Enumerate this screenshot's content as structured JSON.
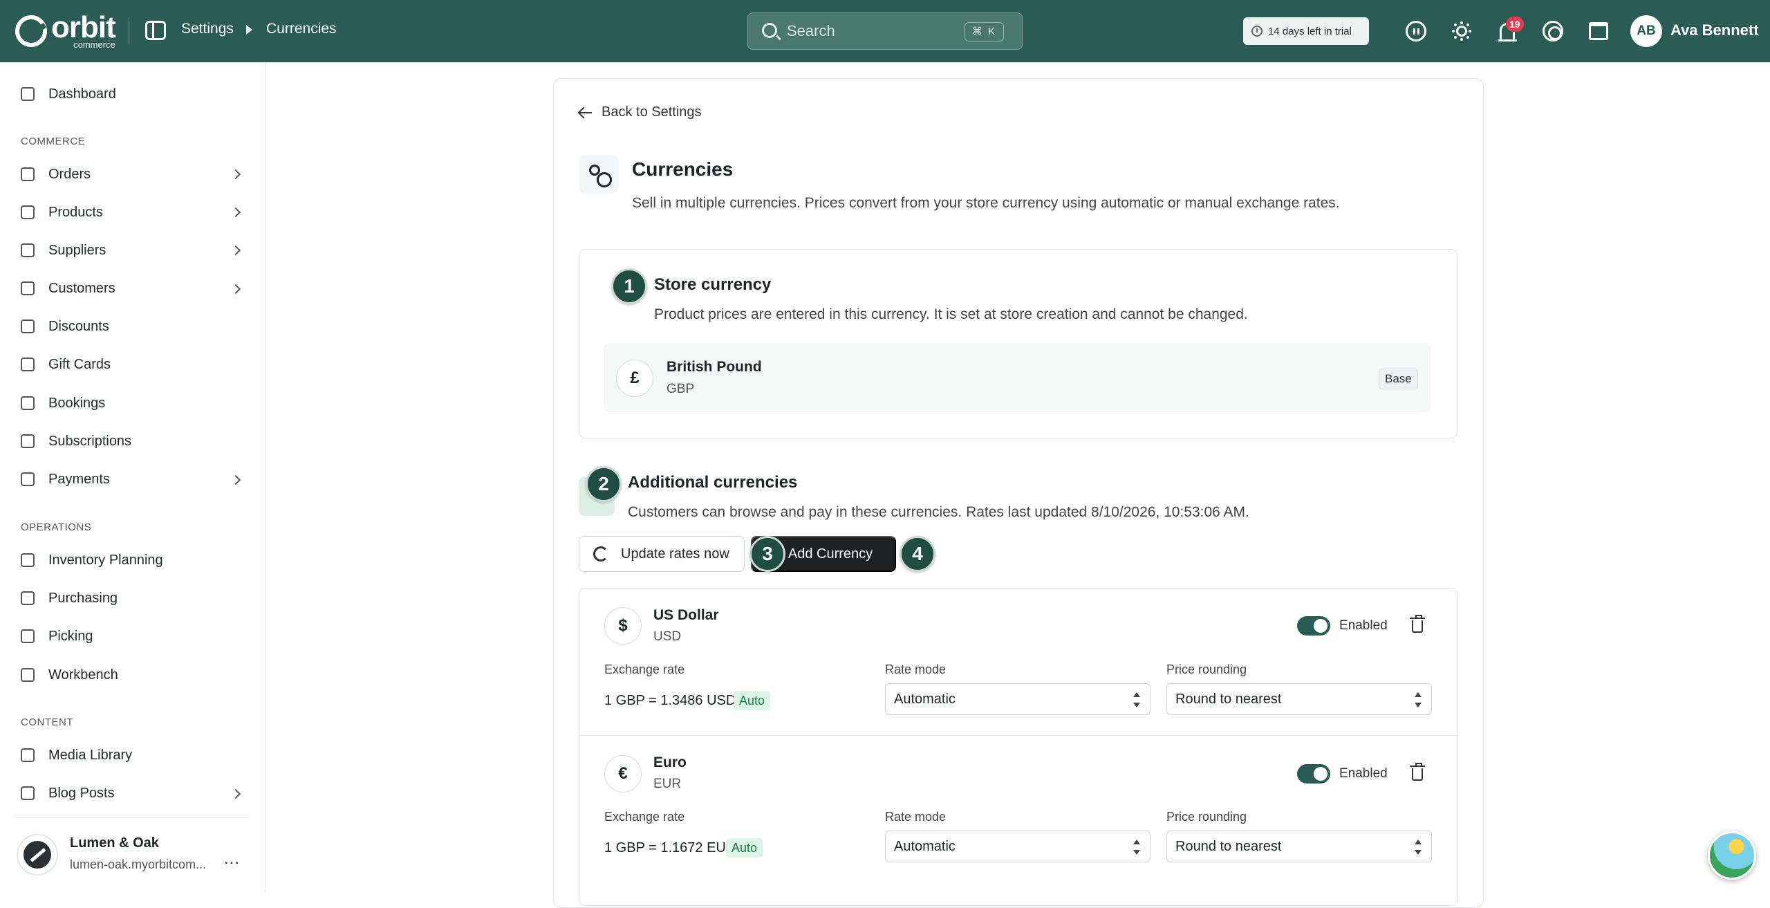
{
  "topbar": {
    "logo_word": "orbit",
    "logo_sub": "commerce",
    "breadcrumb": [
      "Settings",
      "Currencies"
    ],
    "search_placeholder": "Search",
    "search_shortcut": "⌘ K",
    "trial_text": "14 days left in trial",
    "notifications_count": "19",
    "avatar_initials": "AB",
    "user_name": "Ava Bennett"
  },
  "sidebar": {
    "items": [
      {
        "label": "Dashboard",
        "icon": "dashboard-icon"
      },
      {
        "label": "Orders",
        "icon": "orders-icon",
        "chevron": true
      },
      {
        "label": "Products",
        "icon": "box-icon",
        "chevron": true
      },
      {
        "label": "Suppliers",
        "icon": "building-icon",
        "chevron": true
      },
      {
        "label": "Customers",
        "icon": "users-icon",
        "chevron": true
      },
      {
        "label": "Discounts",
        "icon": "tag-icon"
      },
      {
        "label": "Gift Cards",
        "icon": "gift-icon"
      },
      {
        "label": "Bookings",
        "icon": "calendar-icon"
      },
      {
        "label": "Subscriptions",
        "icon": "refresh-icon"
      },
      {
        "label": "Payments",
        "icon": "card-icon",
        "chevron": true
      },
      {
        "label": "Inventory Planning",
        "icon": "inventory-icon"
      },
      {
        "label": "Purchasing",
        "icon": "cart-icon"
      },
      {
        "label": "Picking",
        "icon": "pin-icon"
      },
      {
        "label": "Workbench",
        "icon": "workbench-icon"
      },
      {
        "label": "Media Library",
        "icon": "image-icon"
      },
      {
        "label": "Blog Posts",
        "icon": "blog-icon",
        "chevron": true
      }
    ],
    "sections": [
      "COMMERCE",
      "OPERATIONS",
      "CONTENT"
    ],
    "store_name": "Lumen & Oak",
    "store_url": "lumen-oak.myorbitcom...",
    "more": "..."
  },
  "main": {
    "back_label": "Back to Settings",
    "title": "Currencies",
    "subtitle": "Sell in multiple currencies. Prices convert from your store currency using automatic or manual exchange rates.",
    "store_currency": {
      "title": "Store currency",
      "subtitle": "Product prices are entered in this currency. It is set at store creation and cannot be changed.",
      "symbol": "£",
      "name": "British Pound",
      "code": "GBP",
      "tag": "Base"
    },
    "additional": {
      "title": "Additional currencies",
      "subtitle": "Customers can browse and pay in these currencies. Rates last updated 8/10/2026, 10:53:06 AM.",
      "update_button": "Update rates now",
      "add_button": "Add Currency"
    },
    "steps": [
      "1",
      "2",
      "3",
      "4"
    ],
    "field_labels": {
      "rate": "Exchange rate",
      "mode": "Rate mode",
      "rounding": "Price rounding",
      "enabled": "Enabled"
    },
    "currencies": [
      {
        "symbol": "$",
        "name": "US Dollar",
        "code": "USD",
        "rate": "1 GBP = 1.3486 USD",
        "rate_tag": "Auto",
        "mode": "Automatic",
        "rounding": "Round to nearest",
        "enabled": true
      },
      {
        "symbol": "€",
        "name": "Euro",
        "code": "EUR",
        "rate": "1 GBP = 1.1672 EUR",
        "rate_tag": "Auto",
        "mode": "Automatic",
        "rounding": "Round to nearest",
        "enabled": true
      }
    ]
  },
  "colors": {
    "topbar": "#2a5c55",
    "step_badge": "#1f4d3f",
    "auto_tag": "#dcf5e6",
    "notification": "#e53950"
  }
}
